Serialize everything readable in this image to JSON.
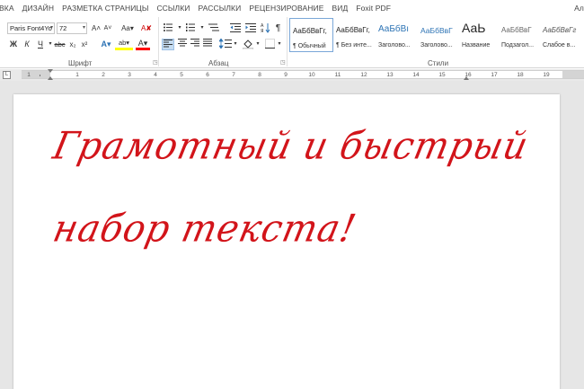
{
  "tabs": [
    "ВКА",
    "ДИЗАЙН",
    "РАЗМЕТКА СТРАНИЦЫ",
    "ССЫЛКИ",
    "РАССЫЛКИ",
    "РЕЦЕНЗИРОВАНИЕ",
    "ВИД",
    "Foxit PDF"
  ],
  "tabs_right": "Ал",
  "font": {
    "name": "Paris Font4Yo",
    "size": "72",
    "group_label": "Шрифт",
    "grow_label": "A˄",
    "shrink_label": "A˅",
    "case_label": "Aa▾",
    "clear_label": "A✘",
    "bold_label": "Ж",
    "italic_label": "К",
    "underline_label": "Ч",
    "strike_label": "abc",
    "sub_label": "x₂",
    "sup_label": "x²",
    "effects_label": "A▾",
    "highlight_label": "ab▾",
    "color_label": "A▾",
    "highlight_color": "#ffff00",
    "font_color": "#ff0000"
  },
  "paragraph": {
    "group_label": "Абзац",
    "pilcrow": "¶"
  },
  "styles": {
    "group_label": "Стили",
    "items": [
      {
        "sample": "АаБбВвГг,",
        "name": "¶ Обычный",
        "sample_size": "8px",
        "color": "#222"
      },
      {
        "sample": "АаБбВвГг,",
        "name": "¶ Без инте...",
        "sample_size": "8px",
        "color": "#222"
      },
      {
        "sample": "АаБбВı",
        "name": "Заголово...",
        "sample_size": "10px",
        "color": "#2e74b5"
      },
      {
        "sample": "АаБбВвГ",
        "name": "Заголово...",
        "sample_size": "8.5px",
        "color": "#2e74b5"
      },
      {
        "sample": "АаЬ",
        "name": "Название",
        "sample_size": "14px",
        "color": "#222"
      },
      {
        "sample": "АаБбВвГ",
        "name": "Подзагол...",
        "sample_size": "8px",
        "color": "#666"
      },
      {
        "sample": "АаБбВвГг",
        "name": "Слабое в...",
        "sample_size": "8px",
        "color": "#555"
      }
    ]
  },
  "ruler": {
    "numbers": [
      "1",
      "1",
      "2",
      "3",
      "4",
      "5",
      "6",
      "7",
      "8",
      "9",
      "10",
      "11",
      "12",
      "13",
      "14",
      "15",
      "16",
      "17",
      "18",
      "19"
    ]
  },
  "document": {
    "line1": "Грамотный и быстрый",
    "line2": "набор текста!",
    "text_color": "#d2141a"
  }
}
